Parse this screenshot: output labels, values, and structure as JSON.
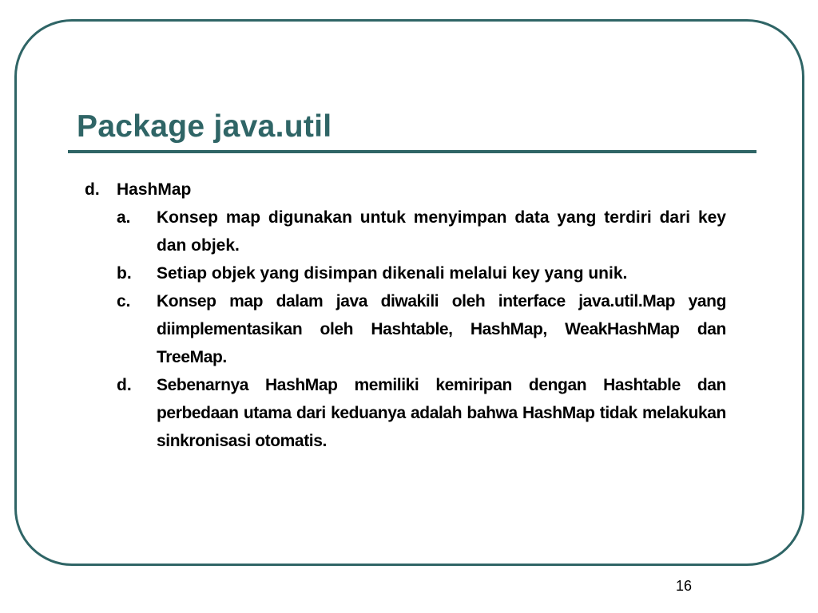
{
  "slide": {
    "title": "Package java.util",
    "page_number": "16",
    "colors": {
      "accent": "#2f6566",
      "text": "#000000",
      "background": "#ffffff"
    },
    "section": {
      "marker": "d.",
      "heading": "HashMap",
      "items": [
        {
          "marker": "a.",
          "text": "Konsep map digunakan untuk menyimpan data yang terdiri dari key dan objek."
        },
        {
          "marker": "b.",
          "text": "Setiap objek yang disimpan dikenali melalui key yang unik."
        },
        {
          "marker": "c.",
          "text": "Konsep map dalam java diwakili oleh interface java.util.Map yang diimplementasikan oleh Hashtable, HashMap, WeakHashMap dan TreeMap."
        },
        {
          "marker": "d.",
          "text": "Sebenarnya HashMap memiliki kemiripan dengan Hashtable dan perbedaan utama dari keduanya adalah bahwa HashMap tidak melakukan sinkronisasi otomatis."
        }
      ]
    }
  }
}
